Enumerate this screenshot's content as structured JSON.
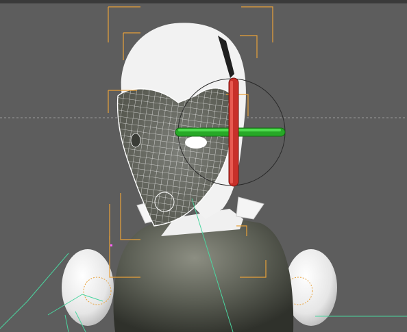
{
  "viewport": {
    "background": "#5d5d5d",
    "top_bar": "#3a3a3a"
  },
  "colors": {
    "bracket": "#e8a13a",
    "mesh_fill": "#f2f2f2",
    "mesh_dark": "#6f716b",
    "wire": "#ffffff",
    "body_dark": "#4a4d44",
    "gizmo_green": "#2fbf2f",
    "gizmo_red": "#c8302a",
    "bone_line": "#4bd6a0",
    "guide_line": "#a8a8a8"
  },
  "objects": [
    {
      "name": "head-mesh",
      "selected": true
    },
    {
      "name": "torso-mesh",
      "selected": false
    },
    {
      "name": "left-shoulder",
      "selected": false
    },
    {
      "name": "right-shoulder",
      "selected": false
    }
  ],
  "gizmo": {
    "type": "rotate"
  }
}
